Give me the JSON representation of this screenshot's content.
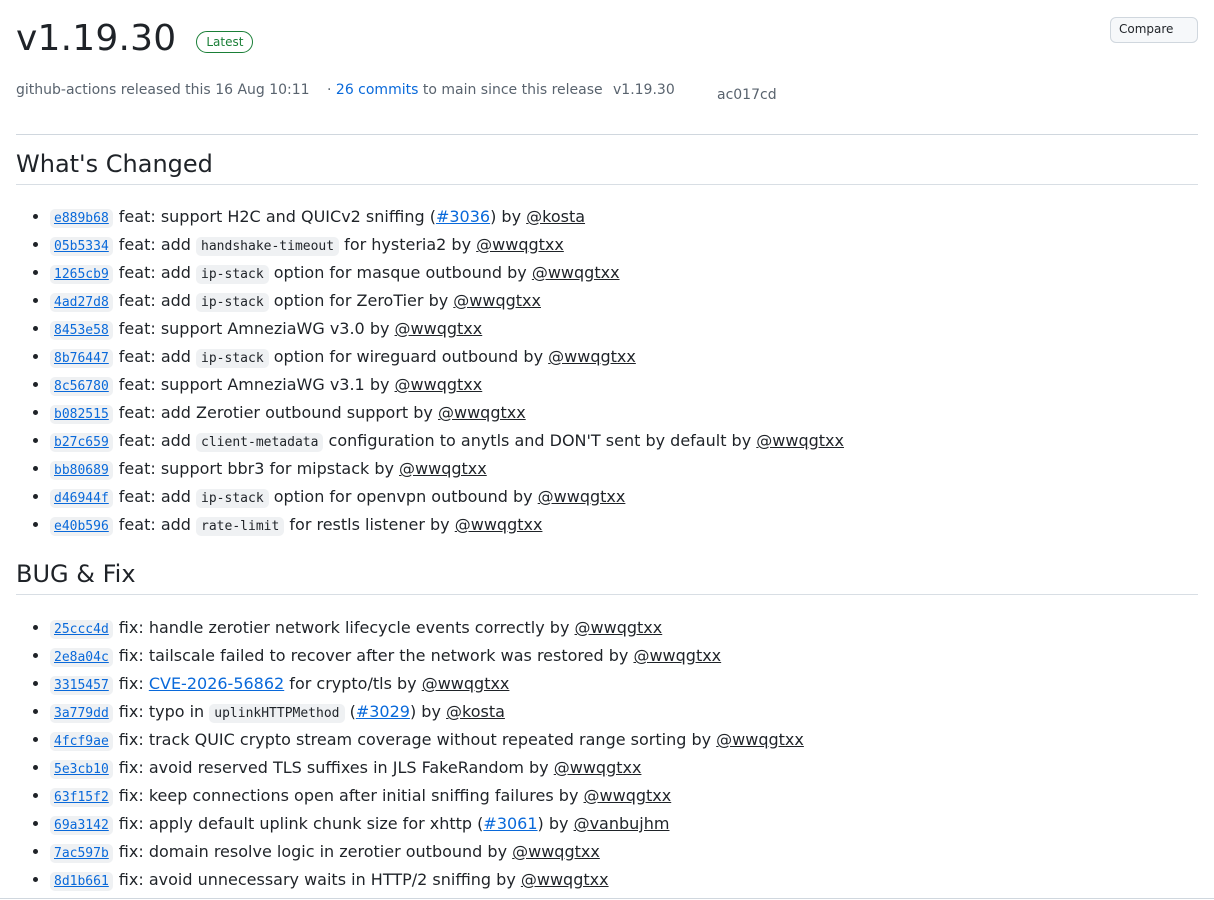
{
  "release": {
    "version": "v1.19.30",
    "badge": "Latest",
    "compare_label": "Compare",
    "author": "github-actions",
    "released_text": "released this",
    "date": "16 Aug 10:11",
    "separator": "·",
    "commits_count": "26 commits",
    "commits_suffix": "to main since this release",
    "tag": "v1.19.30",
    "commit": "ac017cd"
  },
  "whats_changed": {
    "heading": "What's Changed",
    "items": [
      {
        "sha": "e889b68",
        "pre": "feat: support H2C and QUICv2 sniffing (",
        "link": "#3036",
        "post": ") by ",
        "user": "@kosta"
      },
      {
        "sha": "05b5334",
        "pre": "feat: add ",
        "code": "handshake-timeout",
        "post": " for hysteria2 by ",
        "user": "@wwqgtxx"
      },
      {
        "sha": "1265cb9",
        "pre": "feat: add ",
        "code": "ip-stack",
        "post": " option for masque outbound by ",
        "user": "@wwqgtxx"
      },
      {
        "sha": "4ad27d8",
        "pre": "feat: add ",
        "code": "ip-stack",
        "post": " option for ZeroTier by ",
        "user": "@wwqgtxx"
      },
      {
        "sha": "8453e58",
        "pre": "feat: support AmneziaWG v3.0 by ",
        "user": "@wwqgtxx"
      },
      {
        "sha": "8b76447",
        "pre": "feat: add ",
        "code": "ip-stack",
        "post": " option for wireguard outbound by ",
        "user": "@wwqgtxx"
      },
      {
        "sha": "8c56780",
        "pre": "feat: support AmneziaWG v3.1 by ",
        "user": "@wwqgtxx"
      },
      {
        "sha": "b082515",
        "pre": "feat: add Zerotier outbound support by ",
        "user": "@wwqgtxx"
      },
      {
        "sha": "b27c659",
        "pre": "feat: add ",
        "code": "client-metadata",
        "post": " configuration to anytls and DON'T sent by default by ",
        "user": "@wwqgtxx"
      },
      {
        "sha": "bb80689",
        "pre": "feat: support bbr3 for mipstack by ",
        "user": "@wwqgtxx"
      },
      {
        "sha": "d46944f",
        "pre": "feat: add ",
        "code": "ip-stack",
        "post": " option for openvpn outbound by ",
        "user": "@wwqgtxx"
      },
      {
        "sha": "e40b596",
        "pre": "feat: add ",
        "code": "rate-limit",
        "post": " for restls listener by ",
        "user": "@wwqgtxx"
      }
    ]
  },
  "bug_fix": {
    "heading": "BUG & Fix",
    "items": [
      {
        "sha": "25ccc4d",
        "pre": "fix: handle zerotier network lifecycle events correctly by ",
        "user": "@wwqgtxx"
      },
      {
        "sha": "2e8a04c",
        "pre": "fix: tailscale failed to recover after the network was restored by ",
        "user": "@wwqgtxx"
      },
      {
        "sha": "3315457",
        "pre": "fix: ",
        "link": "CVE-2026-56862",
        "post": " for crypto/tls by ",
        "user": "@wwqgtxx"
      },
      {
        "sha": "3a779dd",
        "pre": "fix: typo in ",
        "code": "uplinkHTTPMethod",
        "post": " (",
        "link": "#3029",
        "post2": ") by ",
        "user": "@kosta"
      },
      {
        "sha": "4fcf9ae",
        "pre": "fix: track QUIC crypto stream coverage without repeated range sorting by ",
        "user": "@wwqgtxx"
      },
      {
        "sha": "5e3cb10",
        "pre": "fix: avoid reserved TLS suffixes in JLS FakeRandom by ",
        "user": "@wwqgtxx"
      },
      {
        "sha": "63f15f2",
        "pre": "fix: keep connections open after initial sniffing failures by ",
        "user": "@wwqgtxx"
      },
      {
        "sha": "69a3142",
        "pre": "fix: apply default uplink chunk size for xhttp (",
        "link": "#3061",
        "post": ") by ",
        "user": "@vanbujhm"
      },
      {
        "sha": "7ac597b",
        "pre": "fix: domain resolve logic in zerotier outbound by ",
        "user": "@wwqgtxx"
      },
      {
        "sha": "8d1b661",
        "pre": "fix: avoid unnecessary waits in HTTP/2 sniffing by ",
        "user": "@wwqgtxx"
      }
    ]
  },
  "colors": {
    "link": "#0969da",
    "badge": "#1a7f37",
    "border": "#d0d7de",
    "code_bg": "#eff1f3"
  }
}
